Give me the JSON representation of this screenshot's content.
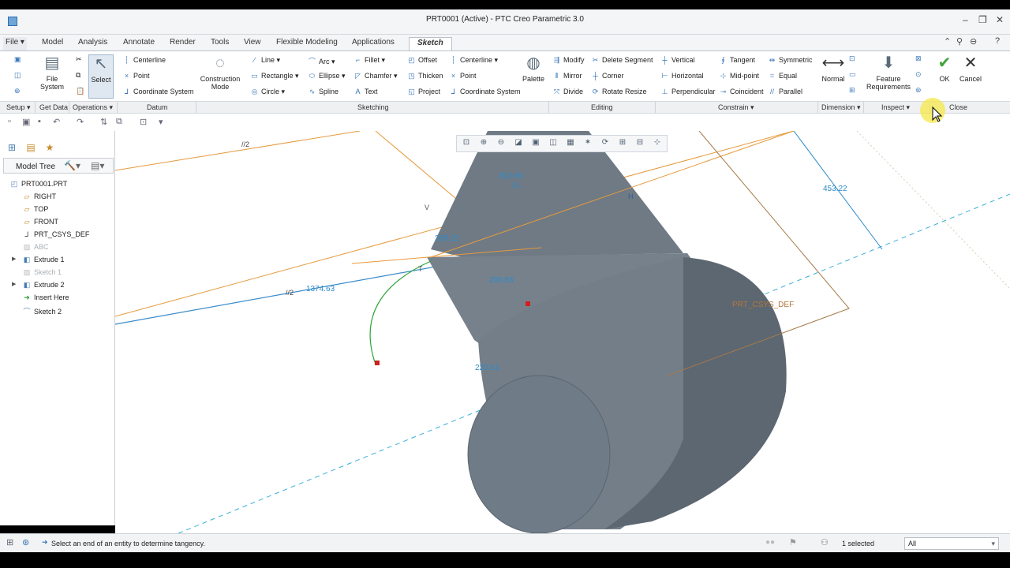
{
  "window": {
    "title": "PRT0001 (Active) - PTC Creo Parametric 3.0"
  },
  "menu": {
    "file": "File ▾",
    "tabs": [
      "Model",
      "Analysis",
      "Annotate",
      "Render",
      "Tools",
      "View",
      "Flexible Modeling",
      "Applications"
    ],
    "active_tab": "Sketch"
  },
  "ribbon": {
    "file_system": "File System",
    "select": "Select",
    "datum": {
      "centerline": "Centerline",
      "point": "Point",
      "coordinate_system": "Coordinate System"
    },
    "construction_mode": "Construction Mode",
    "sketching": {
      "line": "Line",
      "rectangle": "Rectangle",
      "circle": "Circle",
      "arc": "Arc",
      "ellipse": "Ellipse",
      "spline": "Spline",
      "fillet": "Fillet",
      "chamfer": "Chamfer",
      "text": "Text",
      "offset": "Offset",
      "thicken": "Thicken",
      "project": "Project",
      "centerline": "Centerline",
      "point": "Point",
      "coordinate_system": "Coordinate System",
      "palette": "Palette"
    },
    "editing": {
      "modify": "Modify",
      "mirror": "Mirror",
      "divide": "Divide",
      "delete_segment": "Delete Segment",
      "corner": "Corner",
      "rotate_resize": "Rotate Resize"
    },
    "constrain": {
      "vertical": "Vertical",
      "horizontal": "Horizontal",
      "perpendicular": "Perpendicular",
      "tangent": "Tangent",
      "midpoint": "Mid-point",
      "coincident": "Coincident",
      "symmetric": "Symmetric",
      "equal": "Equal",
      "parallel": "Parallel"
    },
    "dimension": {
      "normal": "Normal"
    },
    "inspect": {
      "feature_requirements": "Feature Requirements"
    },
    "close": {
      "ok": "OK",
      "cancel": "Cancel"
    }
  },
  "groups": {
    "setup": "Setup ▾",
    "get_data": "Get Data",
    "operations": "Operations ▾",
    "datum": "Datum",
    "sketching": "Sketching",
    "editing": "Editing",
    "constrain": "Constrain ▾",
    "dimension": "Dimension ▾",
    "inspect": "Inspect ▾",
    "close": "Close"
  },
  "model_tree": {
    "header": "Model Tree",
    "items": [
      {
        "label": "PRT0001.PRT",
        "icon": "part-icon",
        "dim": false
      },
      {
        "label": "RIGHT",
        "icon": "datum-plane-icon",
        "dim": false
      },
      {
        "label": "TOP",
        "icon": "datum-plane-icon",
        "dim": false
      },
      {
        "label": "FRONT",
        "icon": "datum-plane-icon",
        "dim": false
      },
      {
        "label": "PRT_CSYS_DEF",
        "icon": "csys-icon",
        "dim": false
      },
      {
        "label": "ABC",
        "icon": "sketch-icon",
        "dim": true
      },
      {
        "label": "Extrude 1",
        "icon": "extrude-icon",
        "dim": false
      },
      {
        "label": "Sketch 1",
        "icon": "sketch-icon",
        "dim": true
      },
      {
        "label": "Extrude 2",
        "icon": "extrude-icon",
        "dim": false
      },
      {
        "label": "Insert Here",
        "icon": "insert-arrow-icon",
        "dim": false
      },
      {
        "label": "Sketch 2",
        "icon": "sketch-icon",
        "dim": false
      }
    ]
  },
  "viewport": {
    "dimensions": [
      "453.22",
      "1374.63",
      "452.69",
      "268.22",
      "200.86",
      "220.61"
    ],
    "csys_label": "PRT_CSYS_DEF",
    "constraint_labels": [
      "//2",
      "//1",
      "//2",
      "V",
      "H",
      "T"
    ]
  },
  "status": {
    "message": "Select an end of an entity to determine tangency.",
    "selected": "1 selected",
    "filter": "All"
  },
  "colors": {
    "body": "#7b8590",
    "sketch_orange": "#e59a3c",
    "dimension_blue": "#2d8bc9",
    "accent": "#2c6fb0"
  }
}
